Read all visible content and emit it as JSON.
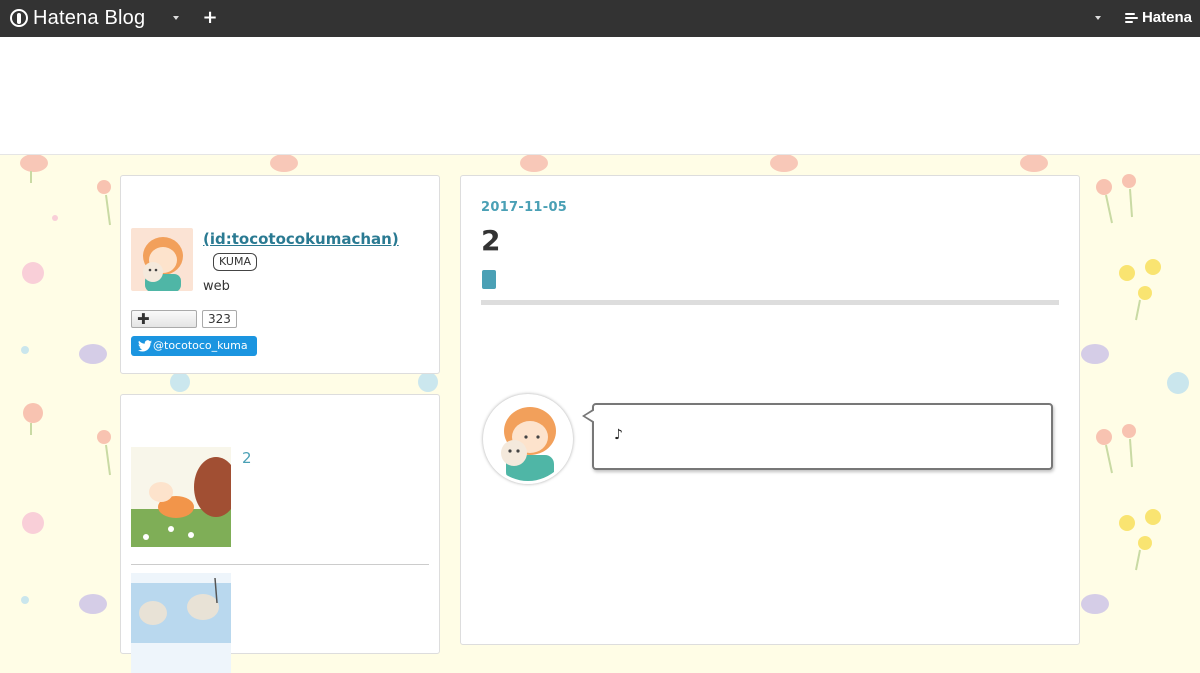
{
  "topbar": {
    "logo_text": "Hatena Blog",
    "plus_label": "+",
    "brand_text": "Hatena"
  },
  "profile": {
    "name": " (id:tocotocokumachan)",
    "badge": "KUMA",
    "description": "web",
    "reader_count": "323",
    "twitter_handle": "@tocotoco_kuma"
  },
  "recent": {
    "items": [
      {
        "title": "2"
      },
      {
        "title": ""
      }
    ]
  },
  "entry": {
    "date": "2017-11-05",
    "title": "2",
    "bubble_text": "♪"
  },
  "colors": {
    "topbar": "#333333",
    "accent": "#4aa0b5",
    "twitter": "#1b95e0",
    "background": "#fffde6"
  },
  "icons": [
    "hatena-blog-logo-icon",
    "chevron-down-icon",
    "plus-icon",
    "hatena-brand-icon",
    "twitter-bird-icon"
  ]
}
